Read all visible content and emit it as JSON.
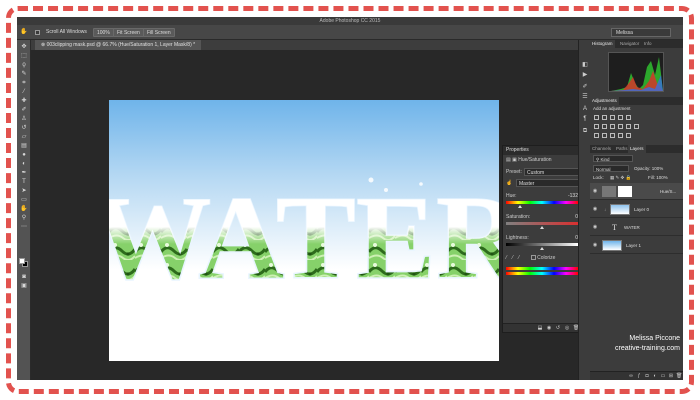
{
  "window": {
    "title": "Adobe Photoshop CC 2015"
  },
  "options_bar": {
    "scroll_all_label": "Scroll All Windows",
    "zoom_label": "100%",
    "fit_screen_label": "Fit Screen",
    "fill_screen_label": "Fill Screen",
    "workspace_label": "Melissa"
  },
  "document": {
    "tab_label": "⊗ 003clipping mask.psd @ 66.7% (Hue/Saturation 1, Layer Mask/8) *",
    "canvas_text": "WATER"
  },
  "properties": {
    "panel_title": "Properties",
    "adjustment_name": "Hue/Saturation",
    "preset_label": "Preset:",
    "preset_value": "Custom",
    "channel_value": "Master",
    "hue_label": "Hue:",
    "hue_value": "-132",
    "saturation_label": "Saturation:",
    "saturation_value": "0",
    "lightness_label": "Lightness:",
    "lightness_value": "0",
    "colorize_label": "Colorize"
  },
  "panels": {
    "top_tabs": [
      "Histogram",
      "Navigator",
      "Info"
    ],
    "adjustments_tab": "Adjustments",
    "adjustments_title": "Add an adjustment",
    "layer_tabs": [
      "Channels",
      "Paths",
      "Layers"
    ],
    "kind_label": "Kind",
    "blend_mode": "Normal",
    "opacity_label": "Opacity: 100%",
    "lock_label": "Lock:",
    "fill_label": "Fill: 100%",
    "layers": [
      {
        "name": "Hue/S...",
        "selected": true
      },
      {
        "name": "Layer 0",
        "selected": false
      },
      {
        "name": "WATER",
        "selected": false
      },
      {
        "name": "Layer 1",
        "selected": false
      }
    ]
  },
  "credit": {
    "name": "Melissa Piccone",
    "site": "creative-training.com"
  },
  "colors": {
    "frame_dash": "#e2524e",
    "canvas_sky": "#6fb4ea",
    "water_green": "#3f8f2a",
    "selected_tab": "#4a4a4a"
  }
}
